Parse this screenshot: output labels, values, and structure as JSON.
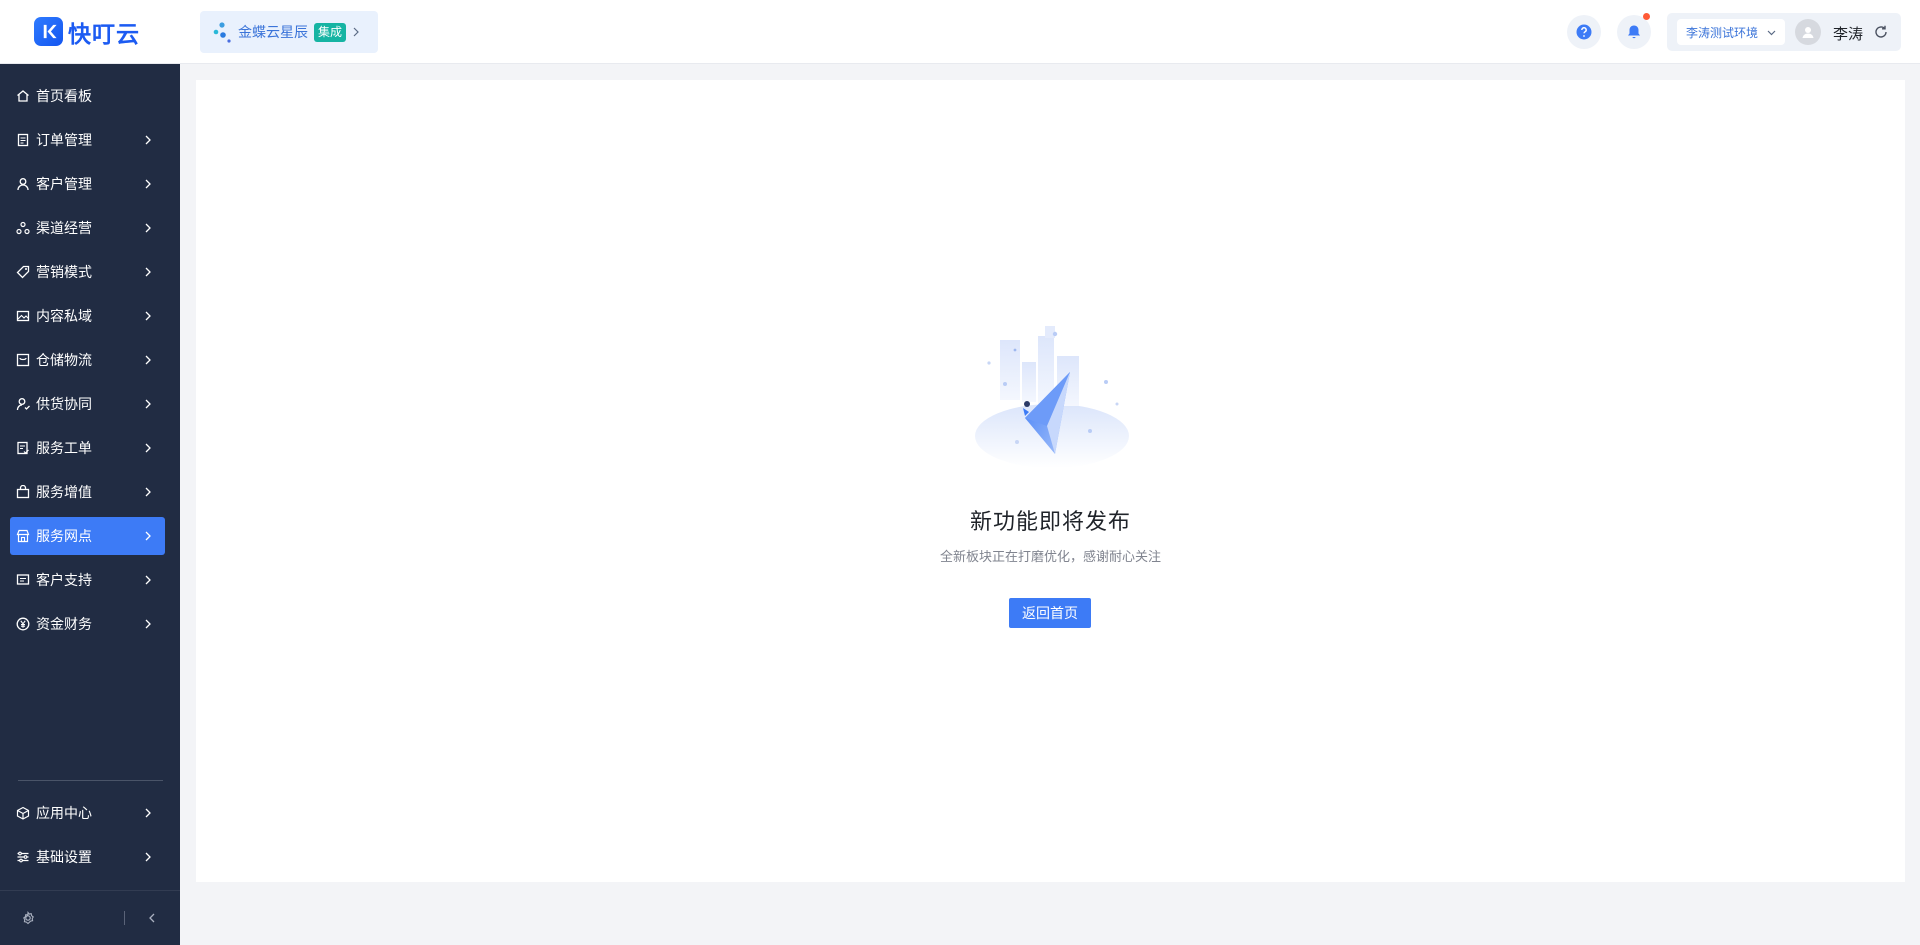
{
  "app": {
    "logo_text": "快叮云",
    "brand_color": "#1c5bf2"
  },
  "header": {
    "integration": {
      "name": "金蝶云星辰",
      "badge": "集成"
    },
    "environment": "李涛测试环境",
    "username": "李涛",
    "icons": [
      "help-icon",
      "bell-icon",
      "refresh-icon"
    ]
  },
  "sidebar": {
    "items": [
      {
        "label": "首页看板",
        "icon": "home-icon",
        "has_children": false
      },
      {
        "label": "订单管理",
        "icon": "clipboard-icon",
        "has_children": true
      },
      {
        "label": "客户管理",
        "icon": "user-icon",
        "has_children": true
      },
      {
        "label": "渠道经营",
        "icon": "channel-icon",
        "has_children": true
      },
      {
        "label": "营销模式",
        "icon": "tag-icon",
        "has_children": true
      },
      {
        "label": "内容私域",
        "icon": "image-icon",
        "has_children": true
      },
      {
        "label": "仓储物流",
        "icon": "warehouse-icon",
        "has_children": true
      },
      {
        "label": "供货协同",
        "icon": "supplier-icon",
        "has_children": true
      },
      {
        "label": "服务工单",
        "icon": "workorder-icon",
        "has_children": true
      },
      {
        "label": "服务增值",
        "icon": "bag-icon",
        "has_children": true
      },
      {
        "label": "服务网点",
        "icon": "store-icon",
        "has_children": true,
        "active": true
      },
      {
        "label": "客户支持",
        "icon": "support-icon",
        "has_children": true
      },
      {
        "label": "资金财务",
        "icon": "yen-icon",
        "has_children": true
      }
    ],
    "bottom_items": [
      {
        "label": "应用中心",
        "icon": "cube-icon",
        "has_children": true
      },
      {
        "label": "基础设置",
        "icon": "sliders-icon",
        "has_children": true
      }
    ],
    "active_color": "#3d7bf6"
  },
  "main": {
    "empty_title": "新功能即将发布",
    "empty_subtitle": "全新板块正在打磨优化，感谢耐心关注",
    "home_button": "返回首页"
  }
}
